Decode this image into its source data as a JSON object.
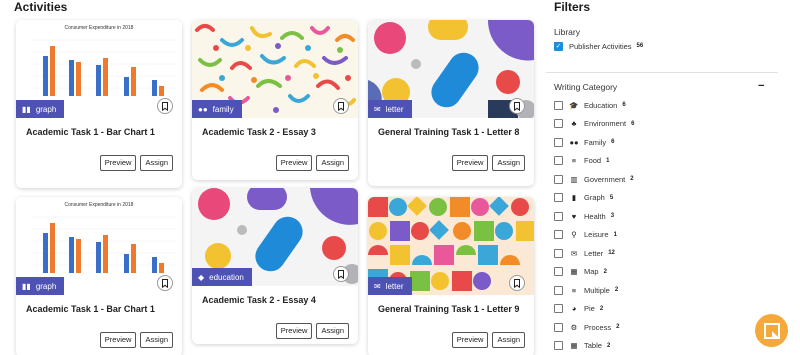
{
  "headings": {
    "activities": "Activities",
    "filters": "Filters"
  },
  "cards": [
    {
      "title": "Academic Task 1 - Bar Chart 1",
      "tag": "graph",
      "chart_title": "Consumer Expenditure in 2018"
    },
    {
      "title": "Academic Task 2 - Essay 3",
      "tag": "family"
    },
    {
      "title": "General Training Task 1 - Letter 8",
      "tag": "letter"
    },
    {
      "title": "Academic Task 1 - Bar Chart 1",
      "tag": "graph",
      "chart_title": "Consumer Expenditure in 2018"
    },
    {
      "title": "Academic Task 2 - Essay 4",
      "tag": "education"
    },
    {
      "title": "General Training Task 1 - Letter 9",
      "tag": "letter"
    }
  ],
  "buttons": {
    "preview": "Preview",
    "assign": "Assign"
  },
  "filters": {
    "library_label": "Library",
    "library_items": [
      {
        "label": "Publisher Activities",
        "count": "56",
        "checked": true
      }
    ],
    "writing_category_label": "Writing Category",
    "collapse_symbol": "−",
    "categories": [
      {
        "label": "Education",
        "count": "6",
        "icon": "graduation-cap-icon"
      },
      {
        "label": "Environment",
        "count": "6",
        "icon": "tree-icon"
      },
      {
        "label": "Family",
        "count": "6",
        "icon": "users-icon"
      },
      {
        "label": "Food",
        "count": "1",
        "icon": "list-icon"
      },
      {
        "label": "Government",
        "count": "2",
        "icon": "building-columns-icon"
      },
      {
        "label": "Graph",
        "count": "5",
        "icon": "chart-icon"
      },
      {
        "label": "Health",
        "count": "3",
        "icon": "heart-pulse-icon"
      },
      {
        "label": "Leisure",
        "count": "1",
        "icon": "bicycle-icon"
      },
      {
        "label": "Letter",
        "count": "12",
        "icon": "envelope-icon"
      },
      {
        "label": "Map",
        "count": "2",
        "icon": "map-icon"
      },
      {
        "label": "Multiple",
        "count": "2",
        "icon": "list-icon"
      },
      {
        "label": "Pie",
        "count": "2",
        "icon": "pie-chart-icon"
      },
      {
        "label": "Process",
        "count": "2",
        "icon": "gear-icon"
      },
      {
        "label": "Table",
        "count": "2",
        "icon": "table-icon"
      }
    ]
  },
  "colors": {
    "badge": "#4f52b5",
    "checkbox": "#1a8fd8",
    "help_bubble": "#f5a93a",
    "bar_blue": "#3a6fc9",
    "bar_orange": "#ef7a2e"
  }
}
